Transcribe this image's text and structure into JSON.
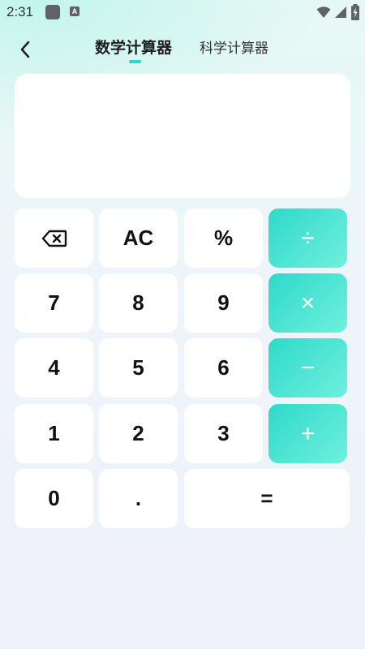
{
  "status_bar": {
    "time": "2:31",
    "a_icon_letter": "A",
    "icons": [
      "app-notification-icon",
      "a-badge-icon",
      "wifi-icon",
      "signal-icon",
      "battery-charging-icon"
    ]
  },
  "header": {
    "back_icon": "chevron-left-icon",
    "tabs": [
      {
        "label": "数学计算器",
        "active": true
      },
      {
        "label": "科学计算器",
        "active": false
      }
    ]
  },
  "display": {
    "expression": "",
    "result": ""
  },
  "keypad": {
    "backspace_icon": "backspace-icon",
    "clear": "AC",
    "percent": "%",
    "divide": "÷",
    "multiply": "×",
    "minus": "−",
    "plus": "+",
    "equals": "=",
    "decimal": ".",
    "digits": {
      "d0": "0",
      "d1": "1",
      "d2": "2",
      "d3": "3",
      "d4": "4",
      "d5": "5",
      "d6": "6",
      "d7": "7",
      "d8": "8",
      "d9": "9"
    }
  },
  "colors": {
    "accent": "#2ad6c8",
    "operator_gradient_start": "#2fd9cb",
    "operator_gradient_end": "#6ff0dc",
    "key_background": "#ffffff",
    "text_primary": "#111111"
  }
}
